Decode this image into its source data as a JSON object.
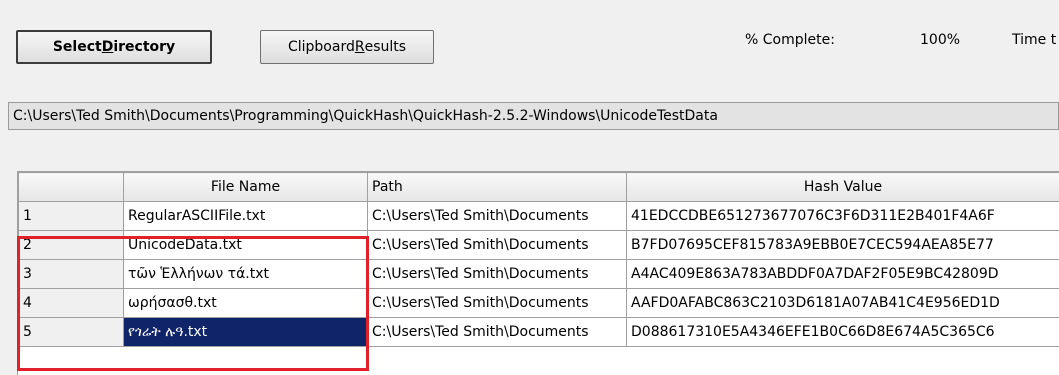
{
  "toolbar": {
    "select_dir_prefix": "Select ",
    "select_dir_underline": "D",
    "select_dir_suffix": "irectory",
    "clipboard_prefix": "Clipboard ",
    "clipboard_underline": "R",
    "clipboard_suffix": "esults"
  },
  "status": {
    "complete_label": "% Complete:",
    "complete_value": "100%",
    "time_label": "Time t"
  },
  "directory_path": "C:\\Users\\Ted Smith\\Documents\\Programming\\QuickHash\\QuickHash-2.5.2-Windows\\UnicodeTestData",
  "grid": {
    "columns": [
      "",
      "File Name",
      "Path",
      "Hash Value"
    ],
    "rows": [
      {
        "num": "1",
        "file": "RegularASCIIFile.txt",
        "path": "C:\\Users\\Ted Smith\\Documents",
        "hash": "41EDCCDBE651273677076C3F6D311E2B401F4A6F"
      },
      {
        "num": "2",
        "file": "UnicodeData.txt",
        "path": "C:\\Users\\Ted Smith\\Documents",
        "hash": "B7FD07695CEF815783A9EBB0E7CEC594AEA85E77"
      },
      {
        "num": "3",
        "file": "τῶν Ἑλλήνων τά.txt",
        "path": "C:\\Users\\Ted Smith\\Documents",
        "hash": "A4AC409E863A783ABDDF0A7DAF2F05E9BC42809D"
      },
      {
        "num": "4",
        "file": "ωρήσασθ.txt",
        "path": "C:\\Users\\Ted Smith\\Documents",
        "hash": "AAFD0AFABC863C2103D6181A07AB41C4E956ED1D"
      },
      {
        "num": "5",
        "file": "የጎሬት ሉዓ.txt",
        "path": "C:\\Users\\Ted Smith\\Documents",
        "hash": "D088617310E5A4346EFE1B0C66D8E674A5C365C6"
      }
    ],
    "selected_row": 5
  },
  "highlight_color": "#e0202a",
  "selection_color": "#10246a"
}
